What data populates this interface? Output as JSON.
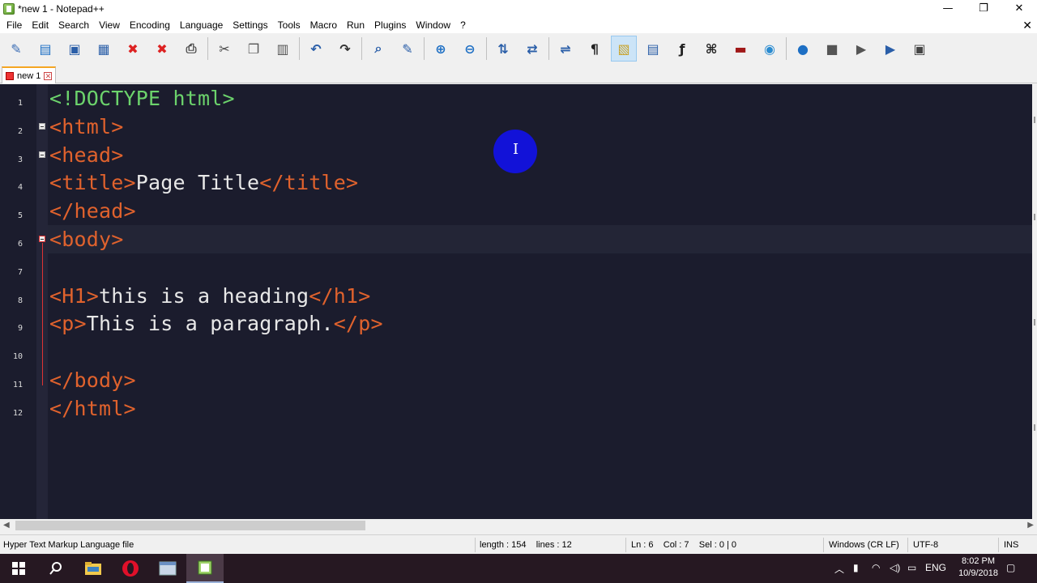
{
  "window": {
    "title": "*new 1 - Notepad++",
    "controls": [
      "—",
      "❐",
      "✕"
    ]
  },
  "menu": [
    "File",
    "Edit",
    "Search",
    "View",
    "Encoding",
    "Language",
    "Settings",
    "Tools",
    "Macro",
    "Run",
    "Plugins",
    "Window",
    "?"
  ],
  "menu_close": "✕",
  "toolbar": [
    {
      "name": "new-file-icon",
      "glyph": "✎",
      "color": "#3b6db4"
    },
    {
      "name": "open-file-icon",
      "glyph": "▤",
      "color": "#1d6fc4"
    },
    {
      "name": "save-icon",
      "glyph": "▣",
      "color": "#2a5ea8"
    },
    {
      "name": "save-all-icon",
      "glyph": "▦",
      "color": "#2a5ea8"
    },
    {
      "name": "close-icon",
      "glyph": "✖",
      "color": "#d22"
    },
    {
      "name": "close-all-icon",
      "glyph": "✖",
      "color": "#d22"
    },
    {
      "name": "print-icon",
      "glyph": "⎙",
      "color": "#444"
    },
    {
      "sep": true
    },
    {
      "name": "cut-icon",
      "glyph": "✂",
      "color": "#444"
    },
    {
      "name": "copy-icon",
      "glyph": "❐",
      "color": "#555"
    },
    {
      "name": "paste-icon",
      "glyph": "▥",
      "color": "#555"
    },
    {
      "sep": true
    },
    {
      "name": "undo-icon",
      "glyph": "↶",
      "color": "#2a5ea8"
    },
    {
      "name": "redo-icon",
      "glyph": "↷",
      "color": "#333"
    },
    {
      "sep": true
    },
    {
      "name": "find-icon",
      "glyph": "⌕",
      "color": "#2a5ea8"
    },
    {
      "name": "replace-icon",
      "glyph": "✎",
      "color": "#2a5ea8"
    },
    {
      "sep": true
    },
    {
      "name": "zoom-in-icon",
      "glyph": "⊕",
      "color": "#1d6fc4"
    },
    {
      "name": "zoom-out-icon",
      "glyph": "⊖",
      "color": "#1d6fc4"
    },
    {
      "sep": true
    },
    {
      "name": "sync-vertical-icon",
      "glyph": "⇅",
      "color": "#2a5ea8"
    },
    {
      "name": "sync-horizontal-icon",
      "glyph": "⇄",
      "color": "#2a5ea8"
    },
    {
      "sep": true
    },
    {
      "name": "word-wrap-icon",
      "glyph": "⇌",
      "color": "#2a5ea8"
    },
    {
      "name": "show-all-chars-icon",
      "glyph": "¶",
      "color": "#222"
    },
    {
      "name": "indent-guide-icon",
      "glyph": "▧",
      "color": "#c9a227",
      "active": true
    },
    {
      "name": "document-map-icon",
      "glyph": "▤",
      "color": "#2a5ea8"
    },
    {
      "name": "function-list-icon",
      "glyph": "ƒ",
      "color": "#222"
    },
    {
      "name": "folder-workspace-icon",
      "glyph": "⌘",
      "color": "#222"
    },
    {
      "name": "monitor-icon",
      "glyph": "▬",
      "color": "#a01818"
    },
    {
      "name": "view-eye-icon",
      "glyph": "◉",
      "color": "#2a8bd0"
    },
    {
      "sep": true
    },
    {
      "name": "macro-record-icon",
      "glyph": "●",
      "color": "#1d6fc4"
    },
    {
      "name": "macro-stop-icon",
      "glyph": "■",
      "color": "#555"
    },
    {
      "name": "macro-play-icon",
      "glyph": "▶",
      "color": "#555"
    },
    {
      "name": "macro-run-multiple-icon",
      "glyph": "▶",
      "color": "#2a5ea8"
    },
    {
      "name": "macro-save-icon",
      "glyph": "▣",
      "color": "#444"
    }
  ],
  "tab": {
    "label": "new 1",
    "close": "✕"
  },
  "editor": {
    "line_numbers": [
      "1",
      "2",
      "3",
      "4",
      "5",
      "6",
      "7",
      "8",
      "9",
      "10",
      "11",
      "12"
    ],
    "lines": [
      [
        {
          "t": "<!DOCTYPE html>",
          "c": "doct"
        }
      ],
      [
        {
          "t": "<html>",
          "c": "tag"
        }
      ],
      [
        {
          "t": "<head>",
          "c": "tag"
        }
      ],
      [
        {
          "t": "<title>",
          "c": "tag"
        },
        {
          "t": "Page Title",
          "c": "txt"
        },
        {
          "t": "</title>",
          "c": "tag"
        }
      ],
      [
        {
          "t": "</head>",
          "c": "tag"
        }
      ],
      [
        {
          "t": "<body>",
          "c": "tag"
        }
      ],
      [],
      [
        {
          "t": "<H1>",
          "c": "tag"
        },
        {
          "t": "this is a heading",
          "c": "txt"
        },
        {
          "t": "</h1>",
          "c": "tag"
        }
      ],
      [
        {
          "t": "<p>",
          "c": "tag"
        },
        {
          "t": "This is a paragraph.",
          "c": "txt"
        },
        {
          "t": "</p>",
          "c": "tag"
        }
      ],
      [],
      [
        {
          "t": "</body>",
          "c": "tag"
        }
      ],
      [
        {
          "t": "</html>",
          "c": "tag"
        }
      ]
    ],
    "cursor_glyph": "I"
  },
  "status": {
    "filetype": "Hyper Text Markup Language file",
    "length": "length : 154    lines : 12",
    "position": "Ln : 6    Col : 7    Sel : 0 | 0",
    "eol": "Windows (CR LF)",
    "encoding": "UTF-8",
    "mode": "INS"
  },
  "taskbar": {
    "language": "ENG",
    "time": "8:02 PM",
    "date": "10/9/2018"
  }
}
